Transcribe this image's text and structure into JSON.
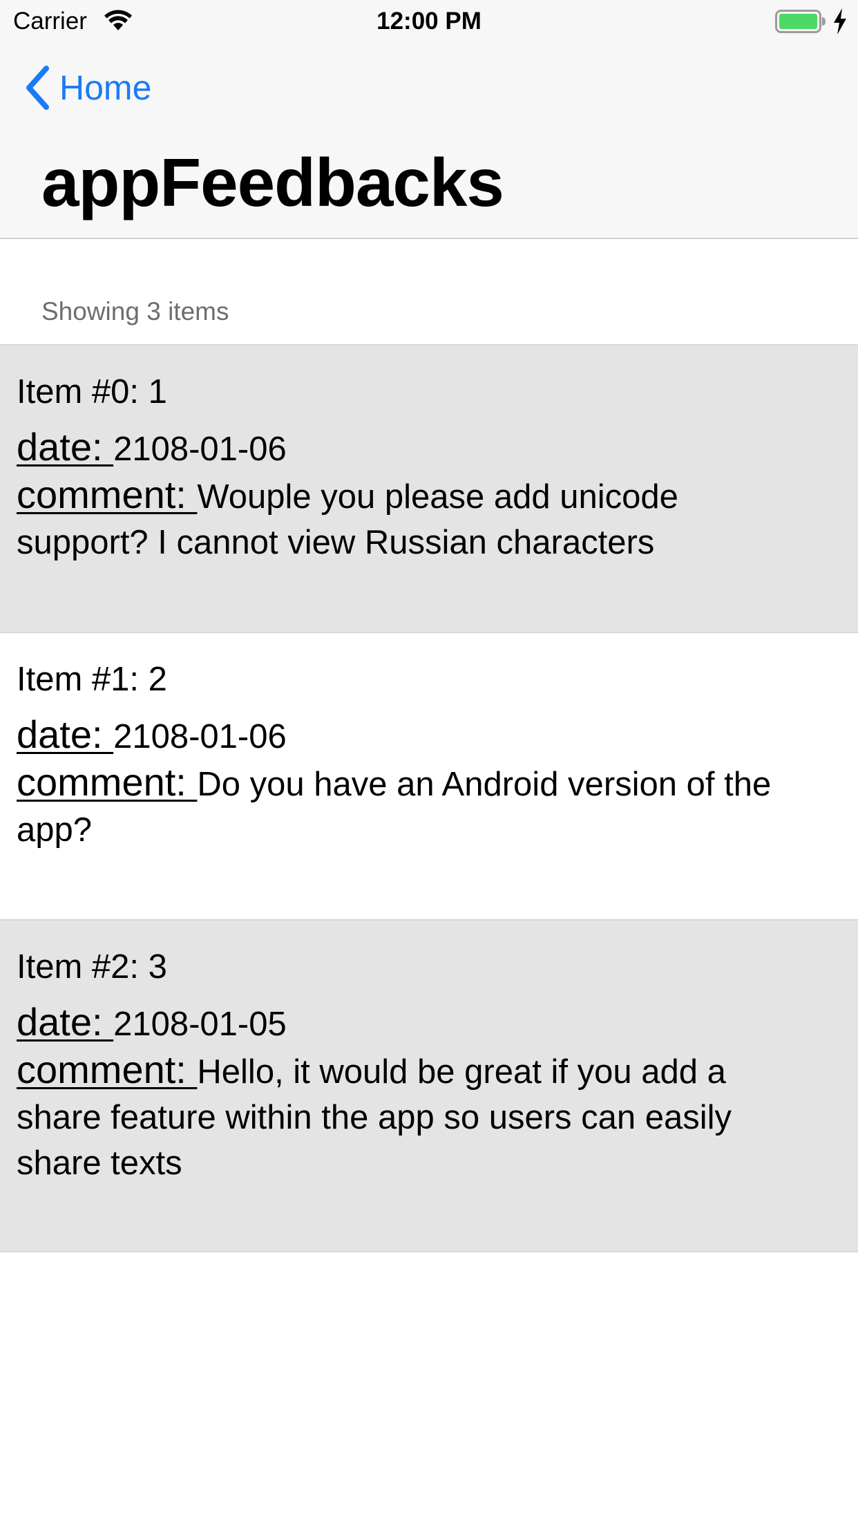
{
  "status_bar": {
    "carrier": "Carrier",
    "time": "12:00 PM",
    "wifi_icon": "wifi-icon",
    "battery_icon": "battery-icon",
    "charging_icon": "bolt-icon",
    "battery_color": "#4cd964",
    "battery_level": 1.0
  },
  "nav": {
    "back_label": "Home",
    "back_icon": "chevron-left-icon",
    "title": "appFeedbacks",
    "accent_color": "#1a7bf6"
  },
  "section": {
    "count_text": "Showing 3 items"
  },
  "items": [
    {
      "heading": "Item #0: 1",
      "date_key": "date: ",
      "date_value": "2108-01-06",
      "comment_key": "comment: ",
      "comment_value": "Wouple you please add unicode support? I cannot view Russian characters"
    },
    {
      "heading": "Item #1: 2",
      "date_key": "date: ",
      "date_value": "2108-01-06",
      "comment_key": "comment: ",
      "comment_value": "Do you have an Android version of the app?"
    },
    {
      "heading": "Item #2: 3",
      "date_key": "date: ",
      "date_value": "2108-01-05",
      "comment_key": "comment: ",
      "comment_value": "Hello, it would be great if you add a share feature within the app so users can easily share texts"
    }
  ]
}
